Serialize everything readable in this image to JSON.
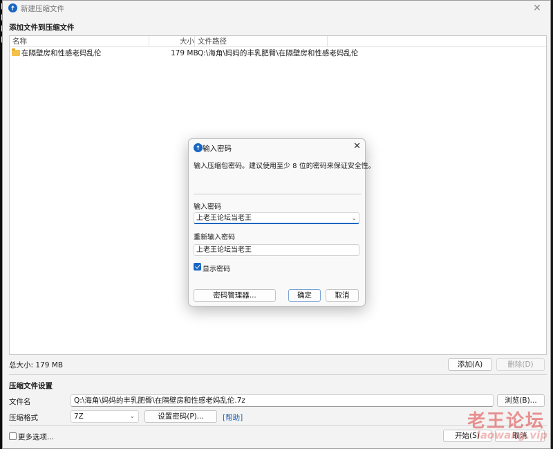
{
  "window": {
    "title": "新建压缩文件",
    "close_glyph": "✕"
  },
  "files_section": {
    "title": "添加文件到压缩文件"
  },
  "file_list": {
    "columns": [
      "名称",
      "大小",
      "文件路径"
    ],
    "rows": [
      {
        "name": "在隔壁房和性感老妈乱伦",
        "size": "179 MB",
        "path": "Q:\\海角\\妈妈的丰乳肥臀\\在隔壁房和性感老妈乱伦"
      }
    ]
  },
  "summary": {
    "total_size": "总大小: 179 MB"
  },
  "list_buttons": {
    "add": "添加(A)",
    "delete": "删除(D)"
  },
  "settings": {
    "title": "压缩文件设置",
    "filename_label": "文件名",
    "filename_value": "Q:\\海角\\妈妈的丰乳肥臀\\在隔壁房和性感老妈乱伦.7z",
    "browse": "浏览(B)...",
    "format_label": "压缩格式",
    "format_value": "7Z",
    "set_password": "设置密码(P)...",
    "help": "[帮助]"
  },
  "footer": {
    "more_options": "更多选项...",
    "start": "开始(S)",
    "cancel": "取消"
  },
  "dialog": {
    "title": "输入密码",
    "close_glyph": "✕",
    "message": "输入压缩包密码。建议使用至少 8 位的密码来保证安全性。",
    "password_label": "输入密码",
    "password_value": "上老王论坛当老王",
    "reenter_label": "重新输入密码",
    "reenter_value": "上老王论坛当老王",
    "show_password": "显示密码",
    "show_password_checked": true,
    "manager": "密码管理器...",
    "ok": "确定",
    "cancel": "取消"
  },
  "watermark": {
    "text": "老王论坛",
    "sub": "laowang.vip"
  },
  "colors": {
    "accent": "#1766c2",
    "folder": "#f4c24a",
    "link": "#1a5fb4"
  }
}
